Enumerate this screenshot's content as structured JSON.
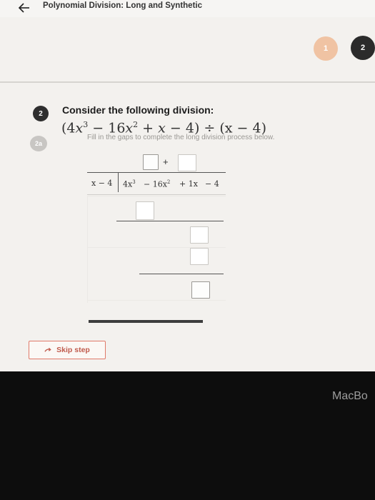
{
  "header": {
    "title": "Polynomial Division: Long and Synthetic",
    "back_icon": "arrow-left-icon"
  },
  "steps": [
    {
      "label": "1",
      "state": "completed",
      "color": "#f0c3a3"
    },
    {
      "label": "2",
      "state": "current",
      "color": "#2b2b2b"
    }
  ],
  "question": {
    "number": "2",
    "subpart": "2a",
    "prompt": "Consider the following division:",
    "expression": {
      "dividend_parts": [
        "(4",
        "x",
        "3",
        " − 16",
        "x",
        "2",
        " + ",
        "x",
        " − 4)"
      ],
      "operator": " ÷ ",
      "divisor": "(x − 4)"
    },
    "instruction": "Fill in the gaps to complete the long division process below."
  },
  "long_division": {
    "quotient_operator": "+",
    "divisor": "x − 4",
    "dividend_terms": [
      "4x",
      "3",
      "− 16x",
      "2",
      "+ 1x",
      "− 4"
    ]
  },
  "actions": {
    "skip_label": "Skip step",
    "skip_icon": "skip-arrow-icon"
  },
  "device": {
    "bezel_label": "MacBo"
  }
}
